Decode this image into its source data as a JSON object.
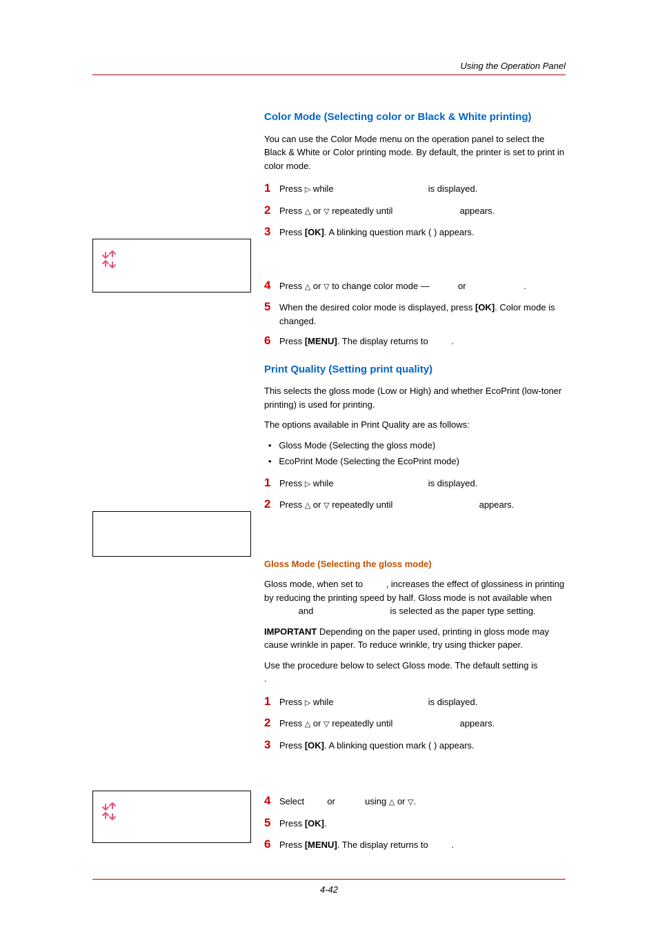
{
  "header": {
    "right": "Using the Operation Panel"
  },
  "footer": {
    "page": "4-42"
  },
  "s1": {
    "title": "Color Mode (Selecting color or Black & White printing)",
    "intro": "You can use the Color Mode menu on the operation panel to select the Black & White or Color printing mode. By default, the printer is set to print in color mode.",
    "step1a": "Press ",
    "step1b": " while ",
    "step1c": " is displayed.",
    "step2a": "Press ",
    "step2b": " or ",
    "step2c": " repeatedly until ",
    "step2d": " appears.",
    "step3a": "Press ",
    "step3b": "[OK]",
    "step3c": ". A blinking question mark ( ) appears.",
    "step4a": "Press ",
    "step4b": " or ",
    "step4c": " to change color mode — ",
    "step4d": " or ",
    "step4e": ".",
    "step5a": "When the desired color mode is displayed, press ",
    "step5b": "[OK]",
    "step5c": ". Color mode is changed.",
    "step6a": "Press ",
    "step6b": "[MENU]",
    "step6c": ". The display returns to ",
    "step6d": "."
  },
  "s2": {
    "title": "Print Quality (Setting print quality)",
    "p1": "This selects the gloss mode (Low or High) and whether EcoPrint (low-toner printing) is used for printing.",
    "p2": "The options available in Print Quality are as follows:",
    "b1": "Gloss Mode (Selecting the gloss mode)",
    "b2": "EcoPrint Mode (Selecting the EcoPrint mode)",
    "step1a": "Press ",
    "step1b": " while ",
    "step1c": " is displayed.",
    "step2a": "Press ",
    "step2b": " or ",
    "step2c": " repeatedly until ",
    "step2d": " appears."
  },
  "s3": {
    "title": "Gloss Mode (Selecting the gloss mode)",
    "p1a": "Gloss mode, when set to ",
    "p1b": ", increases the effect of glossiness in printing by reducing the printing speed by half. Gloss mode is not available when ",
    "p1c": " and ",
    "p1d": " is selected as the paper type setting.",
    "imp_label": "IMPORTANT",
    "imp_body": "  Depending on the paper used, printing in gloss mode may cause wrinkle in paper. To reduce wrinkle, try using thicker paper.",
    "p2a": "Use the procedure below to select Gloss mode. The default setting is ",
    "p2b": ".",
    "step1a": "Press ",
    "step1b": " while ",
    "step1c": " is displayed.",
    "step2a": "Press ",
    "step2b": " or ",
    "step2c": " repeatedly until ",
    "step2d": " appears.",
    "step3a": "Press ",
    "step3b": "[OK]",
    "step3c": ". A blinking question mark ( ) appears.",
    "step4a": "Select ",
    "step4b": " or ",
    "step4c": " using ",
    "step4d": " or ",
    "step4e": ".",
    "step5a": "Press ",
    "step5b": "[OK]",
    "step5c": ".",
    "step6a": "Press ",
    "step6b": "[MENU]",
    "step6c": ". The display returns to ",
    "step6d": "."
  },
  "triangles": {
    "right": "▷",
    "up": "△",
    "down": "▽"
  }
}
